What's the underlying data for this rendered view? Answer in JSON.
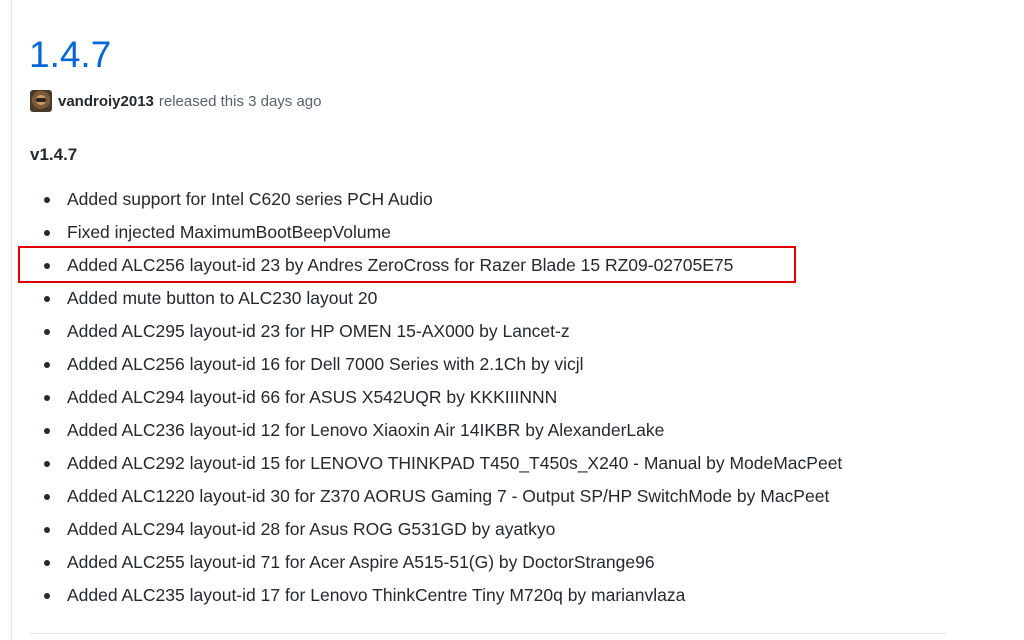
{
  "release": {
    "title": "1.4.7",
    "author": "vandroiy2013",
    "released_text": "released this 3 days ago",
    "version_heading": "v1.4.7"
  },
  "changes": [
    "Added support for Intel C620 series PCH Audio",
    "Fixed injected MaximumBootBeepVolume",
    "Added ALC256 layout-id 23 by Andres ZeroCross for Razer Blade 15 RZ09-02705E75",
    "Added mute button to ALC230 layout 20",
    "Added ALC295 layout-id 23 for HP OMEN 15-AX000 by Lancet-z",
    "Added ALC256 layout-id 16 for Dell 7000 Series with 2.1Ch by vicjl",
    "Added ALC294 layout-id 66 for ASUS X542UQR by KKKIIINNN",
    "Added ALC236 layout-id 12 for Lenovo Xiaoxin Air 14IKBR by AlexanderLake",
    "Added ALC292 layout-id 15 for LENOVO THINKPAD T450_T450s_X240 - Manual by ModeMacPeet",
    "Added ALC1220 layout-id 30 for Z370 AORUS Gaming 7 - Output SP/HP SwitchMode by MacPeet",
    "Added ALC294 layout-id 28 for Asus ROG G531GD by ayatkyo",
    "Added ALC255 layout-id 71 for Acer Aspire A515-51(G) by DoctorStrange96",
    "Added ALC235 layout-id 17 for Lenovo ThinkCentre Tiny M720q by marianvlaza"
  ],
  "highlighted_item_index": 2,
  "colors": {
    "link": "#0366d6",
    "text": "#24292e",
    "muted": "#586069",
    "highlight_border": "#e00000"
  }
}
